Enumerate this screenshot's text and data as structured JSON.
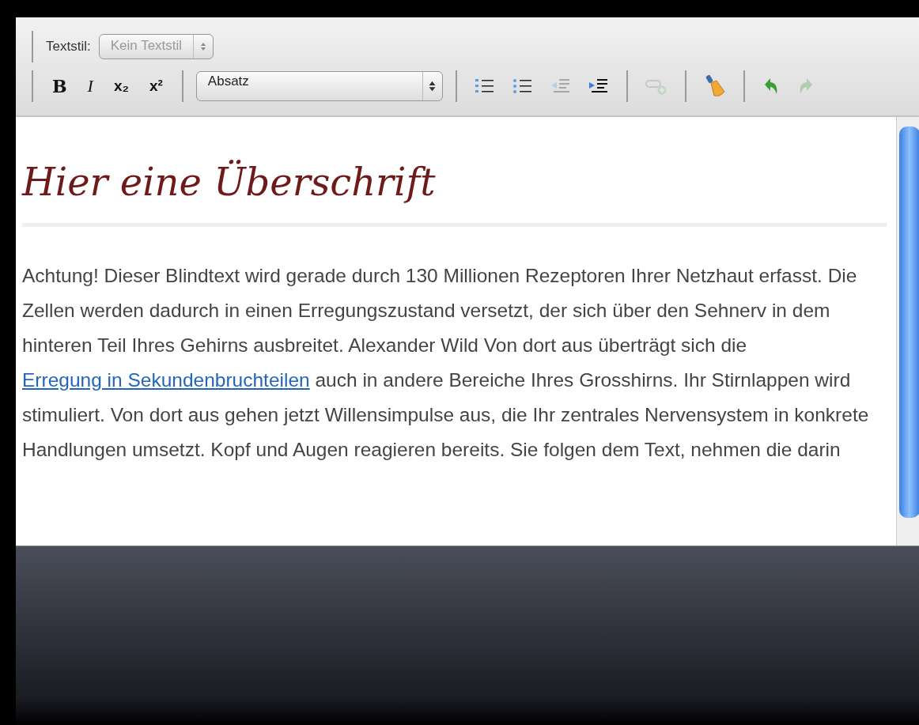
{
  "toolbar": {
    "style_label": "Textstil:",
    "style_select": {
      "value": "Kein Textstil",
      "disabled": true
    },
    "format_buttons": [
      {
        "label": "B",
        "kind": "bold"
      },
      {
        "label": "I",
        "kind": "italic"
      },
      {
        "label": "x₂",
        "kind": "sub"
      },
      {
        "label": "x²",
        "kind": "sup"
      }
    ],
    "block_select": {
      "value": "Absatz",
      "disabled": false
    },
    "icon_groups": [
      [
        {
          "kind": "numbered-list",
          "disabled": false
        },
        {
          "kind": "bullet-list",
          "disabled": false
        },
        {
          "kind": "outdent",
          "disabled": true
        },
        {
          "kind": "indent",
          "disabled": false
        }
      ],
      [
        {
          "kind": "link",
          "disabled": true
        }
      ],
      [
        {
          "kind": "broom",
          "disabled": false
        }
      ],
      [
        {
          "kind": "undo",
          "disabled": false
        },
        {
          "kind": "redo",
          "disabled": true
        }
      ]
    ]
  },
  "content": {
    "heading": "Hier eine Überschrift",
    "paragraph": [
      {
        "text": "Achtung! Dieser Blindtext wird gerade durch 130 Millionen Rezeptoren Ihrer Netzhaut erfasst. Die Zellen werden dadurch in einen Erregungszustand versetzt, der sich über den Sehnerv in dem hinteren Teil Ihres Gehirns ausbreitet. Alexander Wild Von dort aus überträgt sich die ",
        "link": false
      },
      {
        "text": "Erregung in Sekundenbruchteilen",
        "link": true
      },
      {
        "text": " auch in andere Bereiche Ihres Grosshirns. Ihr Stirnlappen wird stimuliert. Von dort aus gehen jetzt Willensimpulse aus, die Ihr zentrales Nervensystem in konkrete Handlungen umsetzt. Kopf und Augen reagieren bereits. Sie folgen dem Text, nehmen die darin",
        "link": false
      }
    ]
  }
}
